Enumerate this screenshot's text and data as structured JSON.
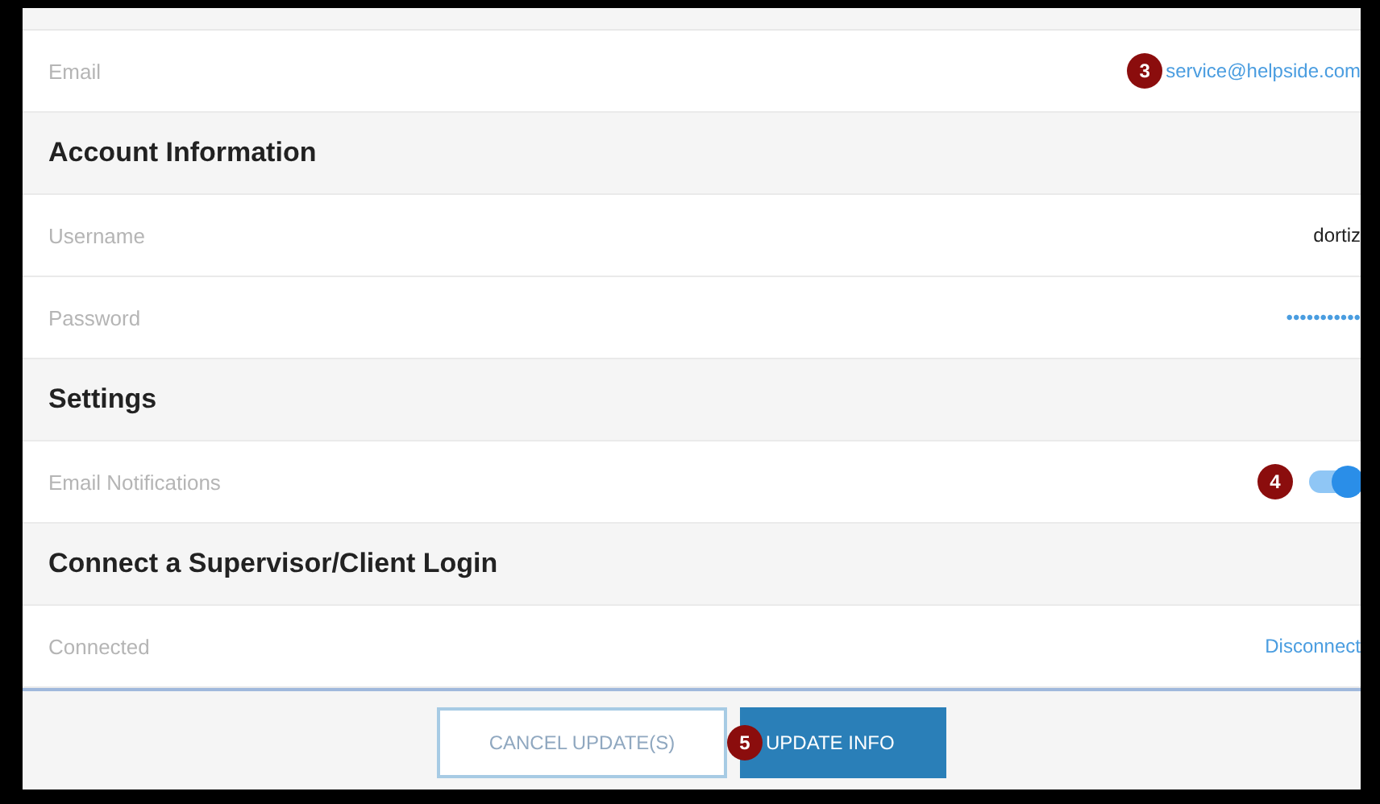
{
  "rows": [
    {
      "kind": "field",
      "label": "Email",
      "value": "service@helpside.com",
      "link": true,
      "marker": "3"
    },
    {
      "kind": "header",
      "label": "Account Information"
    },
    {
      "kind": "field",
      "label": "Username",
      "value": "dortiz",
      "link": false
    },
    {
      "kind": "field",
      "label": "Password",
      "value": "•••••••••••",
      "link": true
    },
    {
      "kind": "header",
      "label": "Settings"
    },
    {
      "kind": "toggle",
      "label": "Email Notifications",
      "on": true,
      "marker": "4"
    },
    {
      "kind": "header",
      "label": "Connect a Supervisor/Client Login"
    },
    {
      "kind": "field",
      "label": "Connected",
      "value": "Disconnect",
      "link": true
    }
  ],
  "buttons": [
    {
      "kind": "outline",
      "label": "CANCEL UPDATE(S)"
    },
    {
      "kind": "primary",
      "label": "UPDATE INFO",
      "marker": "5"
    }
  ]
}
